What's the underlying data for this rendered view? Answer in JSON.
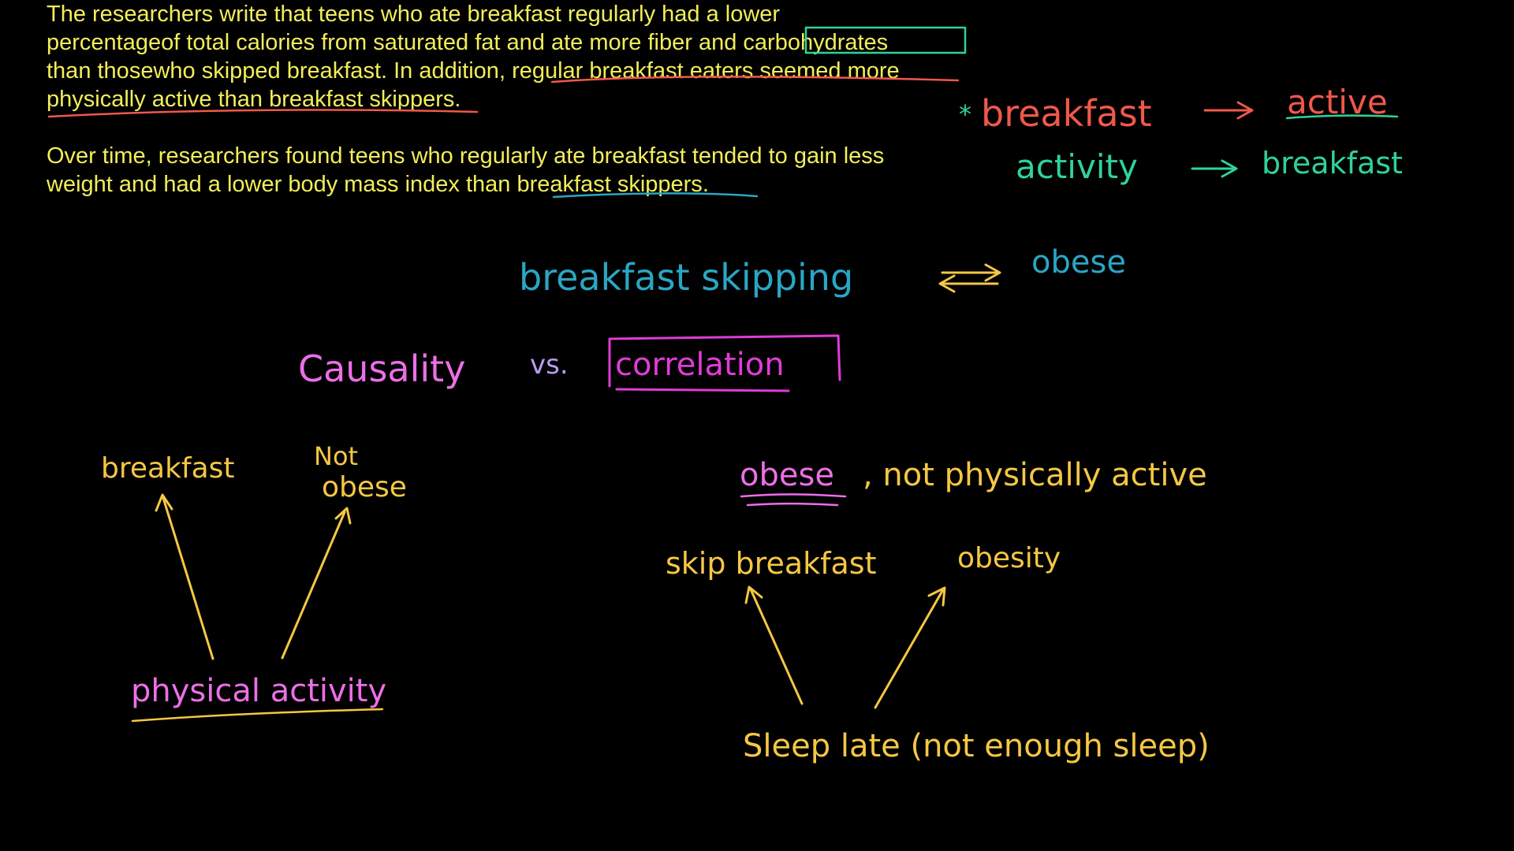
{
  "colors": {
    "background": "#000000",
    "text": "#f2ee5a",
    "red": "#f0584a",
    "green": "#2fd39a",
    "blue": "#2aa6c4",
    "pink": "#ec6fe6",
    "magenta": "#e03cd6",
    "purple": "#b79cf2",
    "yellow": "#f5c744",
    "lavender": "#c9b4f0"
  },
  "text_block": {
    "paragraph1": {
      "line1": "The researchers write that teens who ate breakfast regularly had a lower",
      "line2_a": "percentageof total calories from saturated fat and ate more fiber and ",
      "line2_b": "carbohydrates",
      "line3_a": "than thosewho skipped breakfast. In addition, ",
      "line3_b": "regular breakfast eaters seemed more",
      "line4_a": "physically active than breakfast skippers",
      "line4_b": "."
    },
    "paragraph2": {
      "line1": "Over time, researchers found teens who regularly ate breakfast tended to gain less",
      "line2_a": "weight and had a lower body mass index than ",
      "line2_b": "breakfast skippers",
      "line2_c": "."
    }
  },
  "annotations": {
    "top_right_line1": {
      "star": "*",
      "left": "breakfast",
      "arrow": "→",
      "right": "active"
    },
    "top_right_line2": {
      "left": "activity",
      "arrow": "→",
      "right": "breakfast"
    },
    "center_line": {
      "left": "breakfast skipping",
      "arrow": "⇄",
      "right": "obese"
    },
    "title": {
      "left": "Causality",
      "mid": "vs.",
      "right": "correlation"
    },
    "left_diagram": {
      "top_left": "breakfast",
      "top_right_line1": "Not",
      "top_right_line2": "obese",
      "bottom": "physical activity"
    },
    "right_diagram": {
      "heading_a": "obese",
      "heading_b": ", not physically active",
      "top_left": "skip breakfast",
      "top_right": "obesity",
      "bottom": "Sleep late (not enough sleep)"
    }
  }
}
